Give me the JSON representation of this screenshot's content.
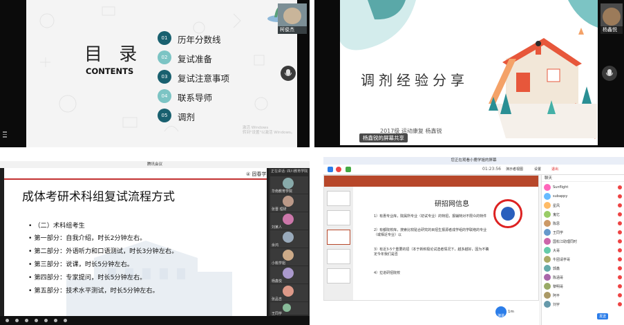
{
  "q1": {
    "title": "目 录",
    "subtitle": "CONTENTS",
    "toc": [
      {
        "num": "01",
        "label": "历年分数线"
      },
      {
        "num": "02",
        "label": "复试准备"
      },
      {
        "num": "03",
        "label": "复试注意事项"
      },
      {
        "num": "04",
        "label": "联系导师"
      },
      {
        "num": "05",
        "label": "调剂"
      }
    ],
    "watermark_line1": "激活 Windows",
    "watermark_line2": "转到\"设置\"以激活 Windows。",
    "participant_name": "柯俊杰",
    "colors": {
      "dark": "#19606f",
      "light": "#7cc4c4"
    }
  },
  "q2": {
    "title": "调剂经验分享",
    "subtitle": "2017级 运动康复 杨鑫锐",
    "share_label": "杨鑫锐的屏幕共享",
    "participant_name": "杨鑫悦"
  },
  "q3": {
    "topbar": "腾讯会议",
    "logo_text": "④ 固春学姐",
    "title": "成体考研术科组复试流程方式",
    "items": [
      "•  （二）术科组考生",
      "•  第一部分：自我介绍，时长2分钟左右。",
      "•  第二部分：外语听力和口语测试，时长3分钟左右。",
      "•  第三部分：说课，时长5分钟左右。",
      "•  第四部分：专家提问，时长5分钟左右。",
      "•  第五部分：技术水平测试，时长5分钟左右。"
    ],
    "side_header": "正在讲话: 四川教育学院",
    "participants": [
      "华南教育学院",
      "张晋 理研",
      "刘某人",
      "余鸿",
      "小桃学姐",
      "杨鑫悦",
      "张品吉",
      "王同学"
    ]
  },
  "q4": {
    "topbar": "您正在观看小鹿学姐的屏幕",
    "time": "01:23:56",
    "buttons": [
      "演示者视图",
      "设置",
      "退出"
    ],
    "doc_title": "研招网信息",
    "paragraphs": [
      "1）有惠专业库，院属所专业（初试专业）的特招，报辅特对不限众的特件",
      "2）有都院校库，搜索比较贴合研究的目招生报源者成学组的学联络的专业（或相近专业）以",
      "3）有近3-5个重要的招（本于新积极论试选者情况下，越多越好，因为不确定今年我们是否",
      "4）拉进研招院校"
    ],
    "zoom_label": "演讲",
    "zoom_text": "1m",
    "chat_header": "聊天",
    "chat_names": [
      "Sunflight",
      "subappy",
      "星风",
      "鬼忆",
      "陈思",
      "王同学",
      "国松江助理同时",
      "大哥",
      "牛团请学哥",
      "郭鑫",
      "陈涵哥",
      "黎明哥",
      "阿平",
      "刘宇"
    ],
    "send_label": "发送"
  }
}
